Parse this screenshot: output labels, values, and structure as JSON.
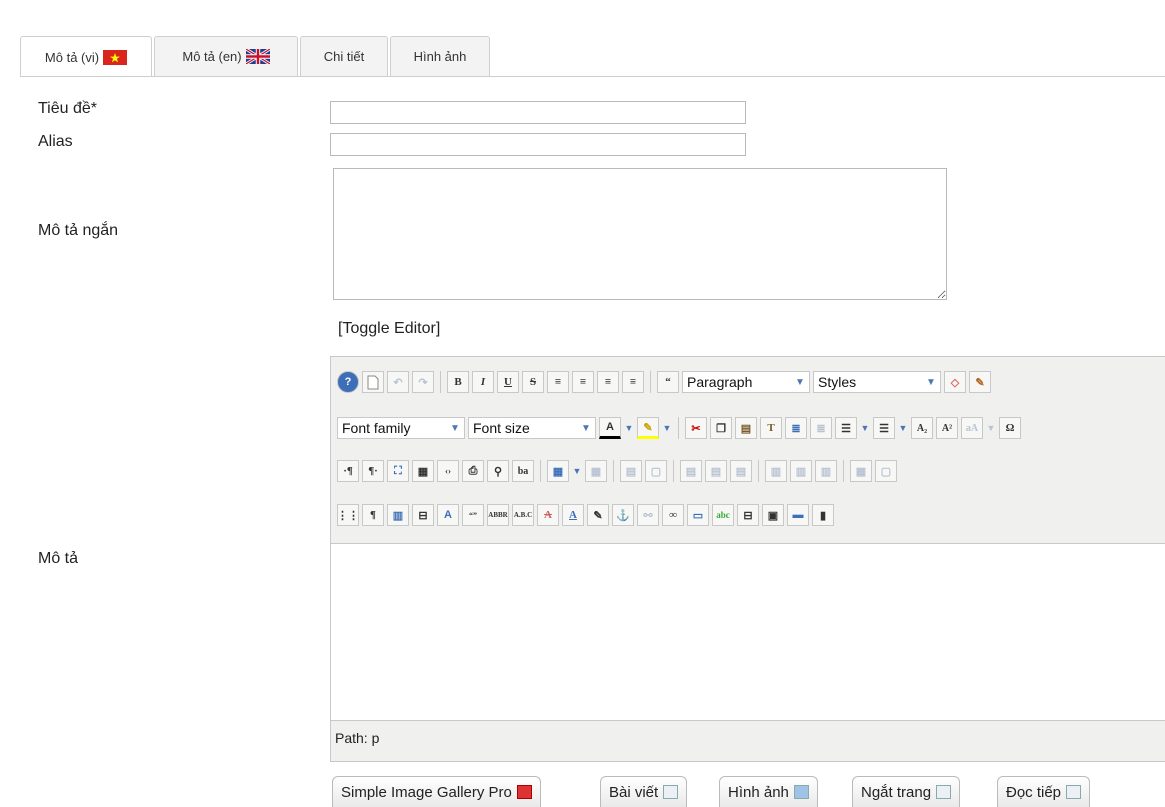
{
  "tabs": [
    {
      "label": "Mô tả (vi)",
      "active": true,
      "flag": "vietnam-flag-icon"
    },
    {
      "label": "Mô tả (en)",
      "active": false,
      "flag": "uk-flag-icon"
    },
    {
      "label": "Chi tiết",
      "active": false
    },
    {
      "label": "Hình ảnh",
      "active": false
    }
  ],
  "form": {
    "title_label": "Tiêu đề*",
    "title_value": "",
    "alias_label": "Alias",
    "alias_value": "",
    "short_desc_label": "Mô tả ngắn",
    "short_desc_value": "",
    "desc_label": "Mô tả",
    "toggle_editor": "[Toggle Editor]"
  },
  "editor": {
    "format_select": "Paragraph",
    "styles_select": "Styles",
    "font_family_select": "Font family",
    "font_size_select": "Font size",
    "path_label": "Path:",
    "path_value": "p",
    "content": ""
  },
  "bottom_buttons": [
    {
      "label": "Simple Image Gallery Pro",
      "icon": "gallery-icon"
    },
    {
      "label": "Bài viết",
      "icon": "article-icon"
    },
    {
      "label": "Hình ảnh",
      "icon": "image-icon"
    },
    {
      "label": "Ngắt trang",
      "icon": "pagebreak-icon"
    },
    {
      "label": "Đọc tiếp",
      "icon": "readmore-icon"
    }
  ],
  "colors": {
    "accent": "#4a76b5",
    "border": "#c8c8c8",
    "vn_red": "#da251d",
    "vn_star": "#ffff00"
  }
}
